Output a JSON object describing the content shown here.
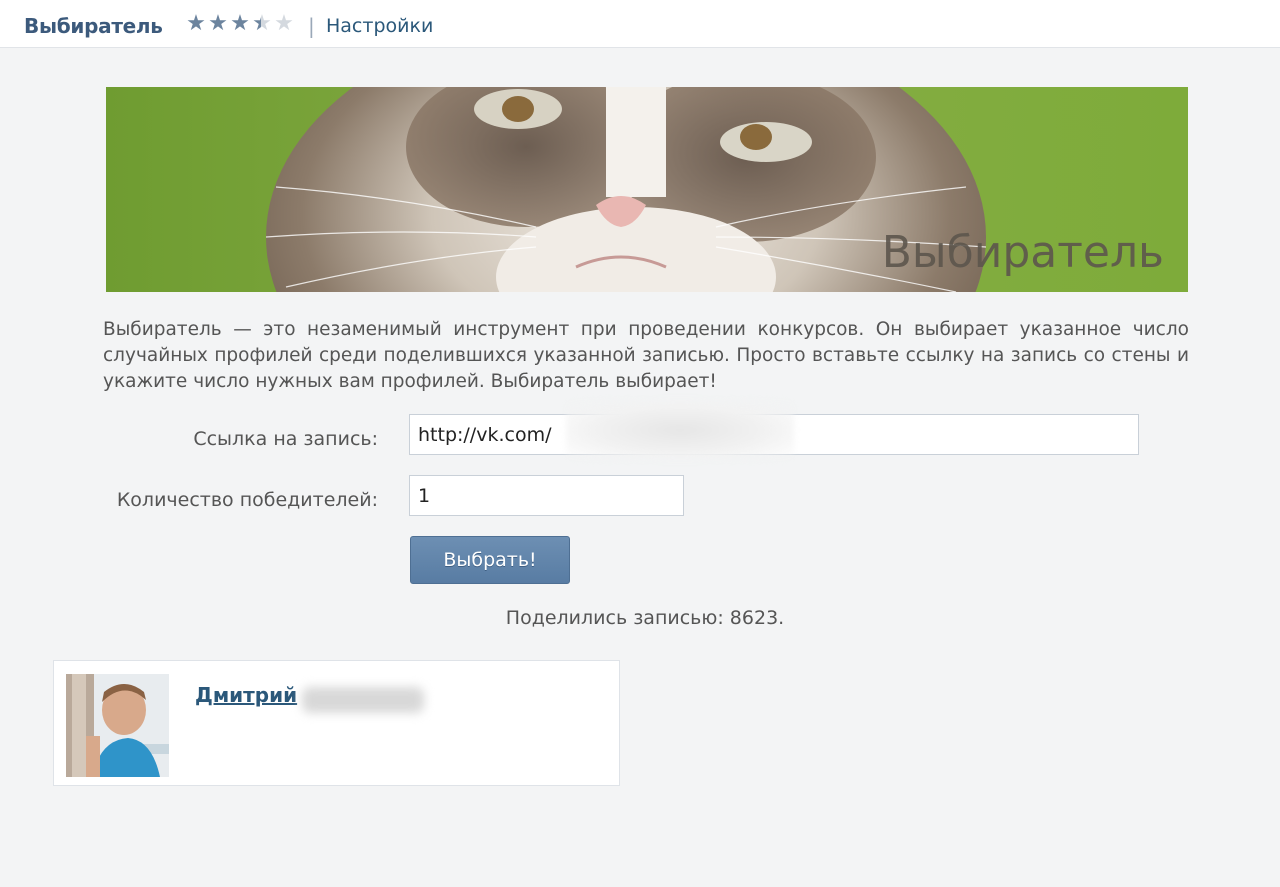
{
  "header": {
    "app_title": "Выбиратель",
    "rating": 3.5,
    "rating_max": 5,
    "divider": "|",
    "settings_label": "Настройки"
  },
  "banner": {
    "caption": "Выбиратель"
  },
  "description": "Выбиратель — это незаменимый инструмент при проведении конкурсов. Он выбирает указанное число случайных профилей среди поделившихся указанной записью. Просто вставьте ссылку на запись со стены и укажите число нужных вам профилей. Выбиратель выбирает!",
  "form": {
    "link_label": "Ссылка на запись:",
    "link_value": "http://vk.com/",
    "count_label": "Количество победителей:",
    "count_value": "1",
    "submit_label": "Выбрать!"
  },
  "shared_text": "Поделились записью: 8623.",
  "winner": {
    "name": "Дмитрий"
  },
  "colors": {
    "brand": "#3c5a7c",
    "link": "#2b587a",
    "button": "#587ca3",
    "background": "#f3f4f5"
  },
  "icons": {
    "star": "star-icon"
  }
}
